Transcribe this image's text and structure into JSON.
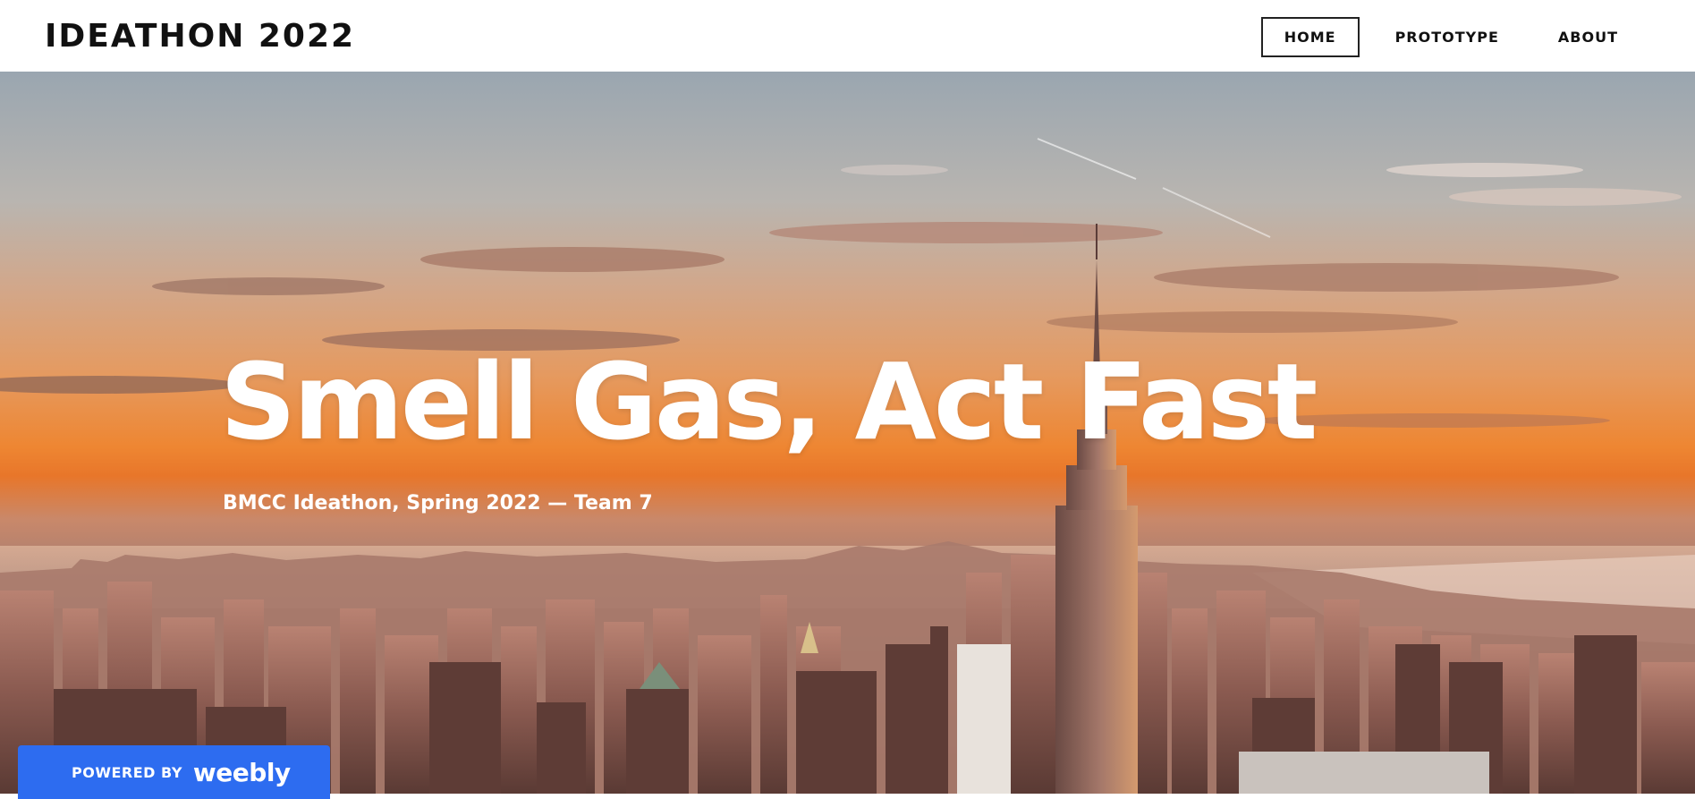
{
  "header": {
    "site_title": "IDEATHON 2022",
    "nav": [
      {
        "label": "HOME",
        "active": true
      },
      {
        "label": "PROTOTYPE",
        "active": false
      },
      {
        "label": "ABOUT",
        "active": false
      }
    ]
  },
  "hero": {
    "heading": "Smell Gas, Act Fast",
    "subtitle": "BMCC Ideathon, Spring 2022 — Team 7",
    "background": "new-york-skyline-sunset-photo"
  },
  "badge": {
    "powered_by": "POWERED BY",
    "brand": "weebly",
    "color": "#2d6cf0"
  },
  "colors": {
    "nav_active_border": "#222222",
    "heading_text": "#ffffff",
    "header_bg": "#ffffff"
  }
}
